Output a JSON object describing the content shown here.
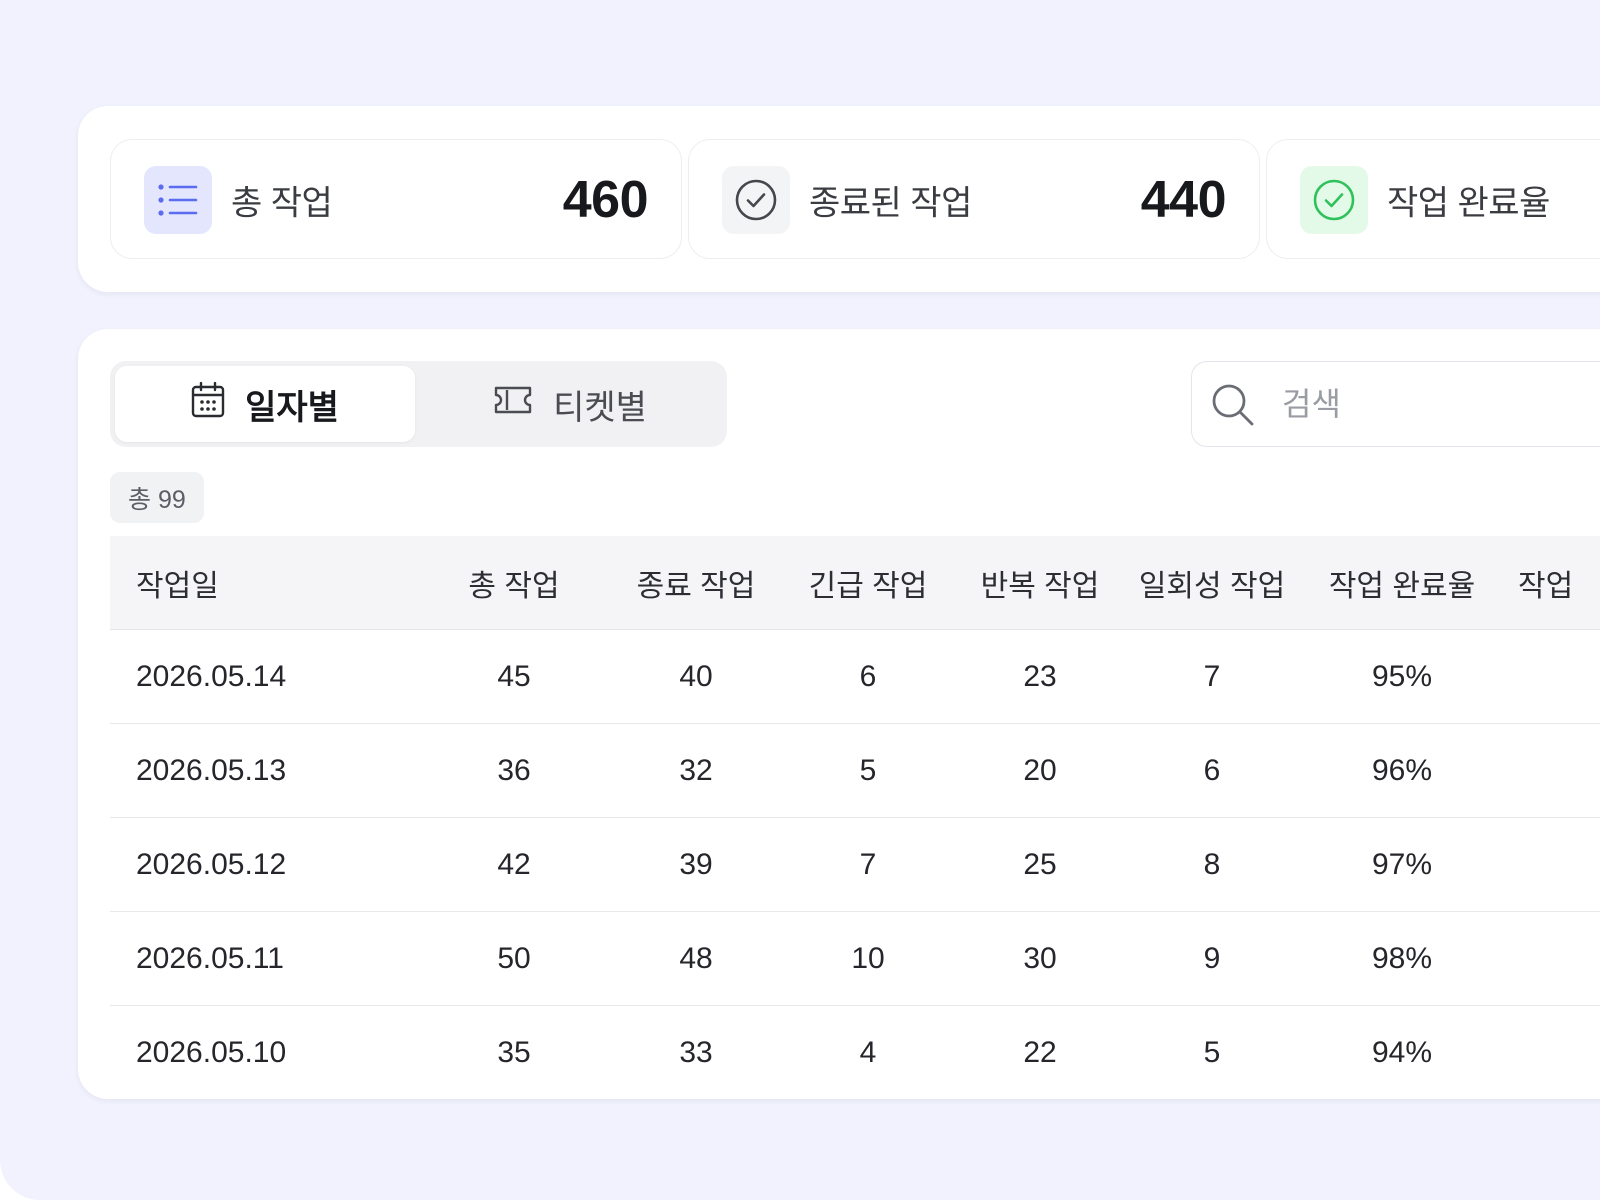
{
  "stats": [
    {
      "label": "총 작업",
      "value": "460",
      "icon": "list-icon"
    },
    {
      "label": "종료된 작업",
      "value": "440",
      "icon": "check-circle-icon"
    },
    {
      "label": "작업 완료율",
      "value": "",
      "icon": "check-circle-green-icon"
    }
  ],
  "tabs": {
    "by_date": "일자별",
    "by_ticket": "티켓별"
  },
  "search": {
    "placeholder": "검색"
  },
  "count_badge": "총 99",
  "table": {
    "headers": [
      "작업일",
      "총 작업",
      "종료 작업",
      "긴급 작업",
      "반복 작업",
      "일회성 작업",
      "작업 완료율",
      "작업"
    ],
    "rows": [
      [
        "2026.05.14",
        "45",
        "40",
        "6",
        "23",
        "7",
        "95%"
      ],
      [
        "2026.05.13",
        "36",
        "32",
        "5",
        "20",
        "6",
        "96%"
      ],
      [
        "2026.05.12",
        "42",
        "39",
        "7",
        "25",
        "8",
        "97%"
      ],
      [
        "2026.05.11",
        "50",
        "48",
        "10",
        "30",
        "9",
        "98%"
      ],
      [
        "2026.05.10",
        "35",
        "33",
        "4",
        "22",
        "5",
        "94%"
      ]
    ]
  },
  "colors": {
    "background": "#f1f2fd",
    "list_icon_bg": "#e3e6fd",
    "list_icon_fg": "#5b6cf0",
    "success_bg": "#e4fae9",
    "success_fg": "#2fc15a"
  }
}
